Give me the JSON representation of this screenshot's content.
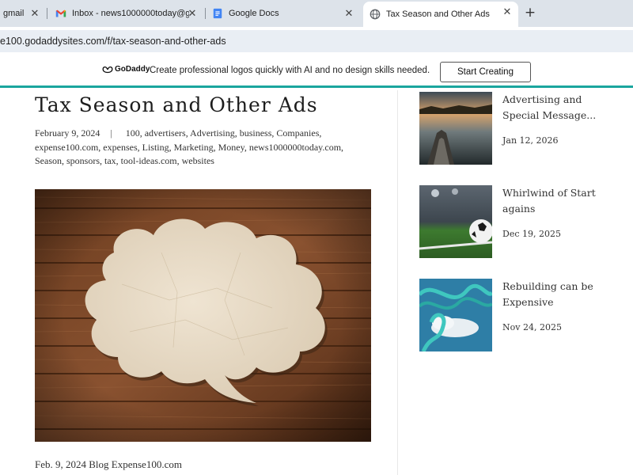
{
  "browser": {
    "tabs": [
      {
        "title": "gmail",
        "icon": "globe-icon"
      },
      {
        "title": "Inbox - news1000000today@g",
        "icon": "gmail-icon"
      },
      {
        "title": "Google Docs",
        "icon": "google-docs-icon"
      },
      {
        "title": "Tax Season and Other Ads",
        "icon": "globe-icon"
      }
    ],
    "url": "e100.godaddysites.com/f/tax-season-and-other-ads"
  },
  "promo": {
    "logo_text": "GoDaddy",
    "message": "Create professional logos quickly with AI and no design skills needed.",
    "button_label": "Start Creating"
  },
  "post": {
    "title": "Tax Season and Other Ads",
    "date": "February 9, 2024",
    "separator": "|",
    "tags": "100, advertisers, Advertising, business, Companies, expense100.com, expenses, Listing, Marketing, Money, news1000000today.com, Season, sponsors, tax, tool-ideas.com, websites",
    "caption": "Feb. 9, 2024 Blog Expense100.com"
  },
  "sidebar": {
    "items": [
      {
        "title": "Advertising and Special Message...",
        "date": "Jan 12, 2026"
      },
      {
        "title": "Whirlwind of Start agains",
        "date": "Dec 19, 2025"
      },
      {
        "title": "Rebuilding can be Expensive",
        "date": "Nov 24, 2025"
      }
    ]
  },
  "colors": {
    "tabstrip": "#dde3ea",
    "accent": "#1aa69e",
    "text": "#1d1d1d"
  }
}
